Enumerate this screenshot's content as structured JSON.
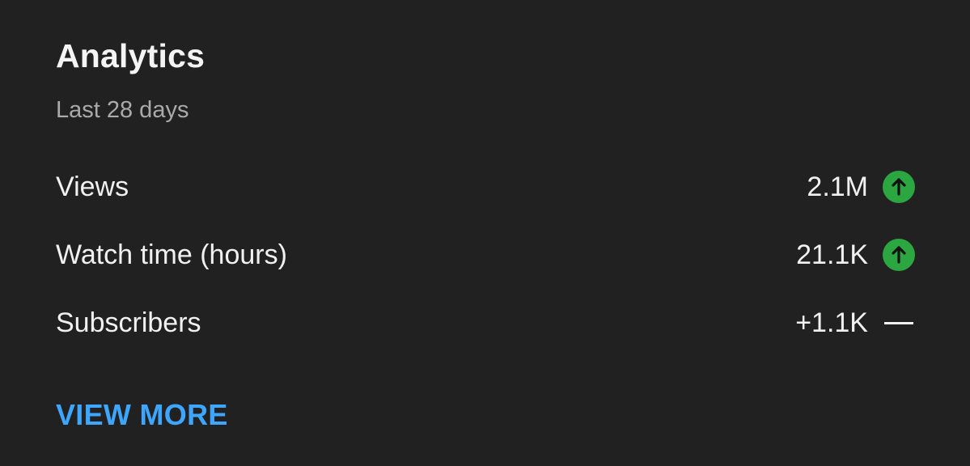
{
  "analytics": {
    "title": "Analytics",
    "period": "Last 28 days",
    "metrics": [
      {
        "label": "Views",
        "value": "2.1M",
        "trend": "up",
        "trend_icon": "arrow-up-icon"
      },
      {
        "label": "Watch time (hours)",
        "value": "21.1K",
        "trend": "up",
        "trend_icon": "arrow-up-icon"
      },
      {
        "label": "Subscribers",
        "value": "+1.1K",
        "trend": "flat",
        "trend_icon": "dash-icon"
      }
    ],
    "view_more_label": "VIEW MORE"
  },
  "colors": {
    "background": "#212121",
    "text": "#f1f1f1",
    "muted": "#aaaaaa",
    "trend_up": "#2ba640",
    "link": "#3ea6ff"
  }
}
